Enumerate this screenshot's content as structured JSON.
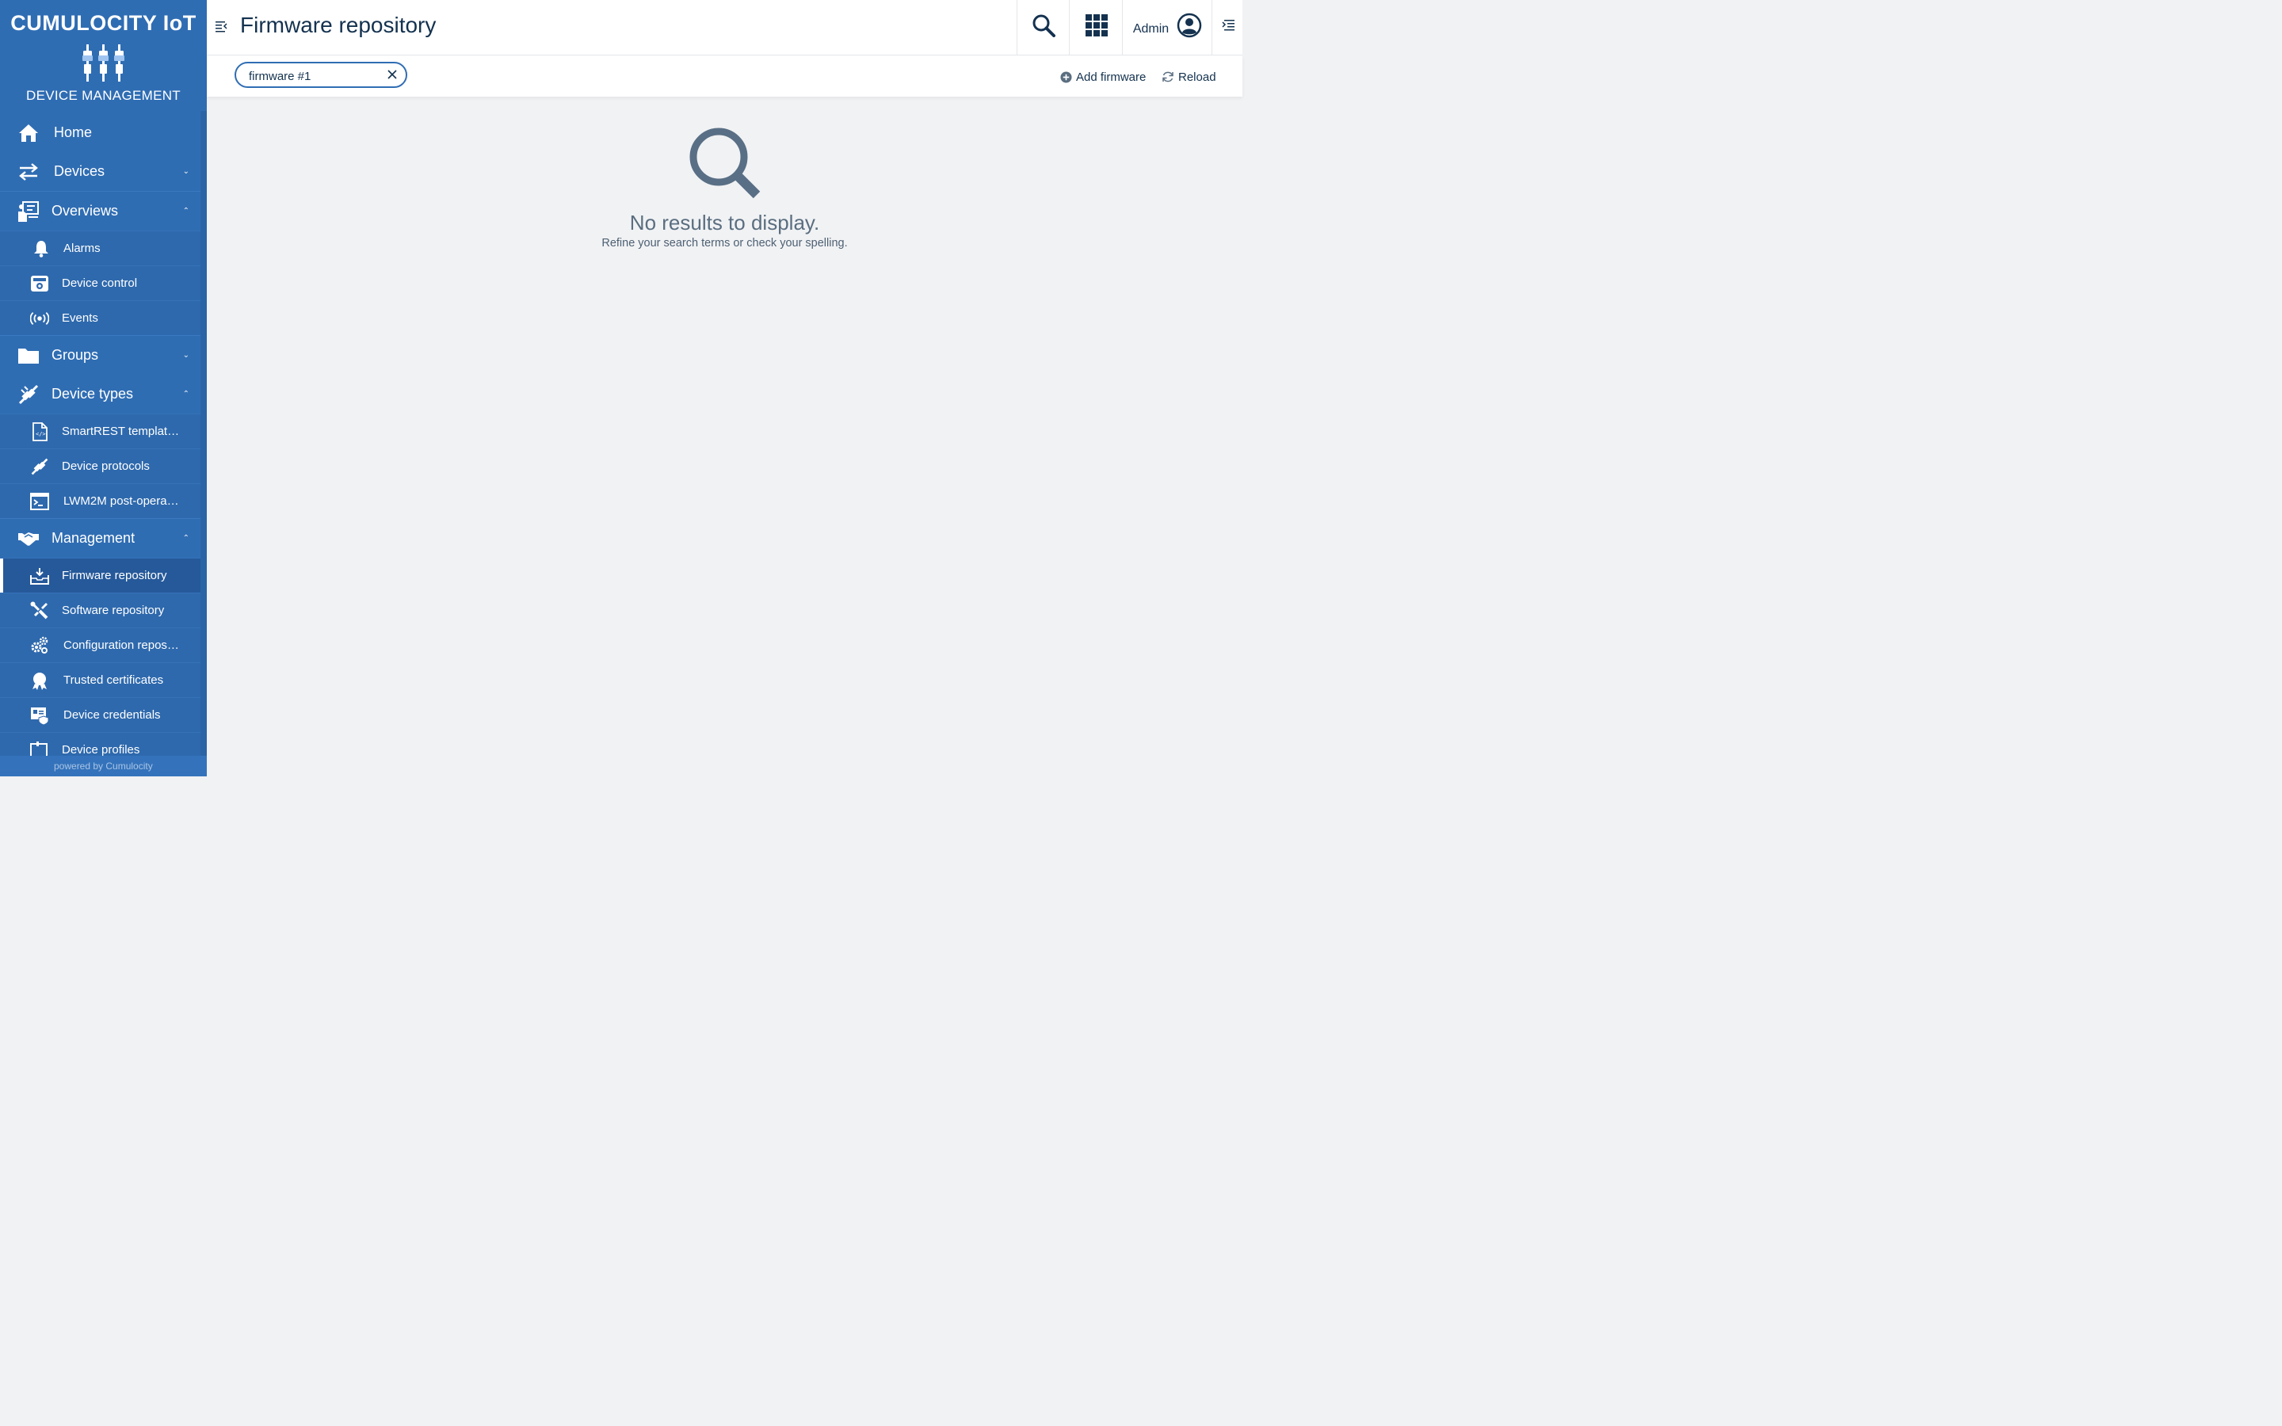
{
  "brand": {
    "title": "CUMULOCITY IoT",
    "subtitle": "DEVICE MANAGEMENT",
    "powered_by": "powered by Cumulocity",
    "accent_color": "#2f6db3"
  },
  "sidebar": {
    "items": [
      {
        "label": "Home",
        "icon": "home-icon"
      },
      {
        "label": "Devices",
        "icon": "arrows-exchange-icon",
        "expanded": false
      },
      {
        "label": "Overviews",
        "icon": "presentation-icon",
        "expanded": true
      },
      {
        "label": "Alarms",
        "icon": "bell-icon"
      },
      {
        "label": "Device control",
        "icon": "device-control-icon"
      },
      {
        "label": "Events",
        "icon": "broadcast-icon"
      },
      {
        "label": "Groups",
        "icon": "folder-icon",
        "expanded": false
      },
      {
        "label": "Device types",
        "icon": "plug-icon",
        "expanded": true
      },
      {
        "label": "SmartREST templat…",
        "icon": "code-file-icon"
      },
      {
        "label": "Device protocols",
        "icon": "plug-icon"
      },
      {
        "label": "LWM2M post-opera…",
        "icon": "terminal-icon"
      },
      {
        "label": "Management",
        "icon": "handshake-icon",
        "expanded": true
      },
      {
        "label": "Firmware repository",
        "icon": "download-tray-icon",
        "active": true
      },
      {
        "label": "Software repository",
        "icon": "tools-icon"
      },
      {
        "label": "Configuration repos…",
        "icon": "gears-icon"
      },
      {
        "label": "Trusted certificates",
        "icon": "badge-icon"
      },
      {
        "label": "Device credentials",
        "icon": "credentials-icon"
      },
      {
        "label": "Device profiles",
        "icon": "profile-icon"
      }
    ]
  },
  "header": {
    "title": "Firmware repository",
    "user": "Admin"
  },
  "actionbar": {
    "search_value": "firmware #1",
    "add_label": "Add firmware",
    "reload_label": "Reload"
  },
  "empty_state": {
    "title": "No results to display.",
    "subtitle": "Refine your search terms or check your spelling."
  }
}
